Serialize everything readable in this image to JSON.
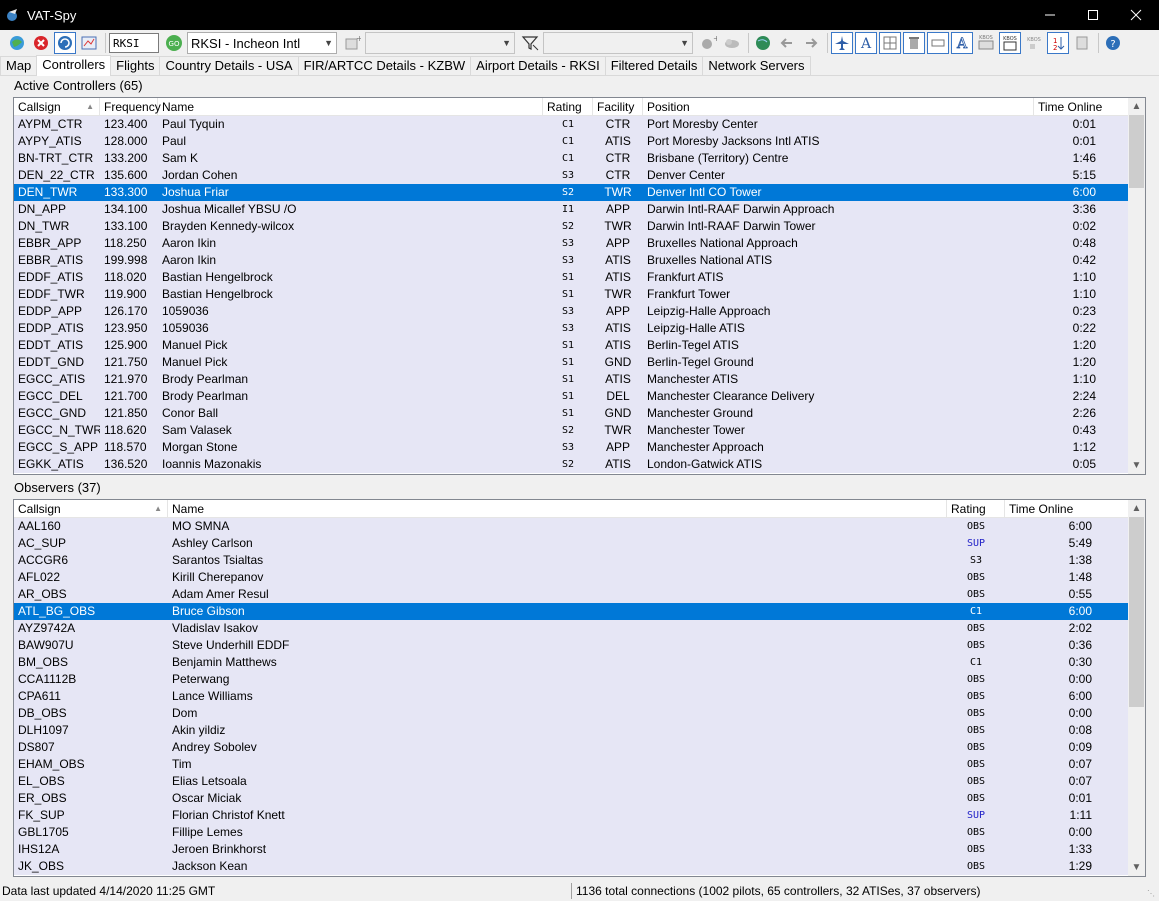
{
  "window": {
    "title": "VAT-Spy"
  },
  "toolbar": {
    "airport_code": "RKSI",
    "airport_select": "RKSI - Incheon Intl",
    "filter_combo_1": "",
    "filter_combo_2": ""
  },
  "tabs": [
    "Map",
    "Controllers",
    "Flights",
    "Country Details - USA",
    "FIR/ARTCC Details - KZBW",
    "Airport Details - RKSI",
    "Filtered Details",
    "Network Servers"
  ],
  "active_tab": "Controllers",
  "controllers": {
    "label": "Active Controllers (65)",
    "columns": [
      "Callsign",
      "Frequency",
      "Name",
      "Rating",
      "Facility",
      "Position",
      "Time Online"
    ],
    "rows": [
      [
        "AYPM_CTR",
        "123.400",
        "Paul Tyquin",
        "C1",
        "CTR",
        "Port Moresby Center",
        "0:01"
      ],
      [
        "AYPY_ATIS",
        "128.000",
        "Paul",
        "C1",
        "ATIS",
        "Port Moresby Jacksons Intl ATIS",
        "0:01"
      ],
      [
        "BN-TRT_CTR",
        "133.200",
        "Sam K",
        "C1",
        "CTR",
        "Brisbane (Territory) Centre",
        "1:46"
      ],
      [
        "DEN_22_CTR",
        "135.600",
        "Jordan Cohen",
        "S3",
        "CTR",
        "Denver Center",
        "5:15"
      ],
      [
        "DEN_TWR",
        "133.300",
        "Joshua Friar",
        "S2",
        "TWR",
        "Denver Intl CO Tower",
        "6:00"
      ],
      [
        "DN_APP",
        "134.100",
        "Joshua Micallef YBSU /O",
        "I1",
        "APP",
        "Darwin Intl-RAAF Darwin Approach",
        "3:36"
      ],
      [
        "DN_TWR",
        "133.100",
        "Brayden Kennedy-wilcox",
        "S2",
        "TWR",
        "Darwin Intl-RAAF Darwin Tower",
        "0:02"
      ],
      [
        "EBBR_APP",
        "118.250",
        "Aaron Ikin",
        "S3",
        "APP",
        "Bruxelles National Approach",
        "0:48"
      ],
      [
        "EBBR_ATIS",
        "199.998",
        "Aaron Ikin",
        "S3",
        "ATIS",
        "Bruxelles National ATIS",
        "0:42"
      ],
      [
        "EDDF_ATIS",
        "118.020",
        "Bastian Hengelbrock",
        "S1",
        "ATIS",
        "Frankfurt ATIS",
        "1:10"
      ],
      [
        "EDDF_TWR",
        "119.900",
        "Bastian Hengelbrock",
        "S1",
        "TWR",
        "Frankfurt Tower",
        "1:10"
      ],
      [
        "EDDP_APP",
        "126.170",
        "1059036",
        "S3",
        "APP",
        "Leipzig-Halle Approach",
        "0:23"
      ],
      [
        "EDDP_ATIS",
        "123.950",
        "1059036",
        "S3",
        "ATIS",
        "Leipzig-Halle ATIS",
        "0:22"
      ],
      [
        "EDDT_ATIS",
        "125.900",
        "Manuel Pick",
        "S1",
        "ATIS",
        "Berlin-Tegel ATIS",
        "1:20"
      ],
      [
        "EDDT_GND",
        "121.750",
        "Manuel Pick",
        "S1",
        "GND",
        "Berlin-Tegel Ground",
        "1:20"
      ],
      [
        "EGCC_ATIS",
        "121.970",
        "Brody Pearlman",
        "S1",
        "ATIS",
        "Manchester ATIS",
        "1:10"
      ],
      [
        "EGCC_DEL",
        "121.700",
        "Brody Pearlman",
        "S1",
        "DEL",
        "Manchester Clearance Delivery",
        "2:24"
      ],
      [
        "EGCC_GND",
        "121.850",
        "Conor Ball",
        "S1",
        "GND",
        "Manchester Ground",
        "2:26"
      ],
      [
        "EGCC_N_TWR",
        "118.620",
        "Sam Valasek",
        "S2",
        "TWR",
        "Manchester Tower",
        "0:43"
      ],
      [
        "EGCC_S_APP",
        "118.570",
        "Morgan Stone",
        "S3",
        "APP",
        "Manchester Approach",
        "1:12"
      ],
      [
        "EGKK_ATIS",
        "136.520",
        "Ioannis Mazonakis",
        "S2",
        "ATIS",
        "London-Gatwick ATIS",
        "0:05"
      ]
    ],
    "selected_row": 4
  },
  "observers": {
    "label": "Observers (37)",
    "columns": [
      "Callsign",
      "Name",
      "Rating",
      "Time Online"
    ],
    "rows": [
      [
        "AAL160",
        "MO SMNA",
        "OBS",
        "6:00"
      ],
      [
        "AC_SUP",
        "Ashley Carlson",
        "SUP",
        "5:49"
      ],
      [
        "ACCGR6",
        "Sarantos Tsialtas",
        "S3",
        "1:38"
      ],
      [
        "AFL022",
        "Kirill Cherepanov",
        "OBS",
        "1:48"
      ],
      [
        "AR_OBS",
        "Adam Amer Resul",
        "OBS",
        "0:55"
      ],
      [
        "ATL_BG_OBS",
        "Bruce Gibson",
        "C1",
        "6:00"
      ],
      [
        "AYZ9742A",
        "Vladislav Isakov",
        "OBS",
        "2:02"
      ],
      [
        "BAW907U",
        "Steve Underhill EDDF",
        "OBS",
        "0:36"
      ],
      [
        "BM_OBS",
        "Benjamin Matthews",
        "C1",
        "0:30"
      ],
      [
        "CCA1112B",
        "Peterwang",
        "OBS",
        "0:00"
      ],
      [
        "CPA611",
        "Lance Williams",
        "OBS",
        "6:00"
      ],
      [
        "DB_OBS",
        "Dom",
        "OBS",
        "0:00"
      ],
      [
        "DLH1097",
        "Akin yildiz",
        "OBS",
        "0:08"
      ],
      [
        "DS807",
        "Andrey Sobolev",
        "OBS",
        "0:09"
      ],
      [
        "EHAM_OBS",
        "Tim",
        "OBS",
        "0:07"
      ],
      [
        "EL_OBS",
        "Elias Letsoala",
        "OBS",
        "0:07"
      ],
      [
        "ER_OBS",
        "Oscar Miciak",
        "OBS",
        "0:01"
      ],
      [
        "FK_SUP",
        "Florian Christof Knett",
        "SUP",
        "1:11"
      ],
      [
        "GBL1705",
        "Fillipe Lemes",
        "OBS",
        "0:00"
      ],
      [
        "IHS12A",
        "Jeroen Brinkhorst",
        "OBS",
        "1:33"
      ],
      [
        "JK_OBS",
        "Jackson Kean",
        "OBS",
        "1:29"
      ]
    ],
    "selected_row": 5
  },
  "status": {
    "updated": "Data last updated 4/14/2020 11:25 GMT",
    "connections": "1136 total connections (1002 pilots, 65 controllers, 32 ATISes, 37 observers)"
  },
  "colors": {
    "selection": "#0078d7",
    "row_bg": "#e6e6f5",
    "sup_rating": "#2323c8",
    "titlebar": "#000000"
  },
  "icons": [
    "connect-icon",
    "stop-icon",
    "refresh-icon",
    "map-icon",
    "go-icon",
    "add-filter-icon",
    "filter-icon",
    "add-airport-icon",
    "weather-icon",
    "globe-icon",
    "back-arrow-icon",
    "forward-arrow-icon",
    "plane-icon",
    "text-a-icon",
    "grid-icon",
    "trash-icon",
    "box-icon",
    "text-a-outline-icon",
    "kbos-label-icon",
    "kbos-box-icon",
    "kbos-small-icon",
    "sort-icon",
    "export-icon",
    "help-icon"
  ]
}
